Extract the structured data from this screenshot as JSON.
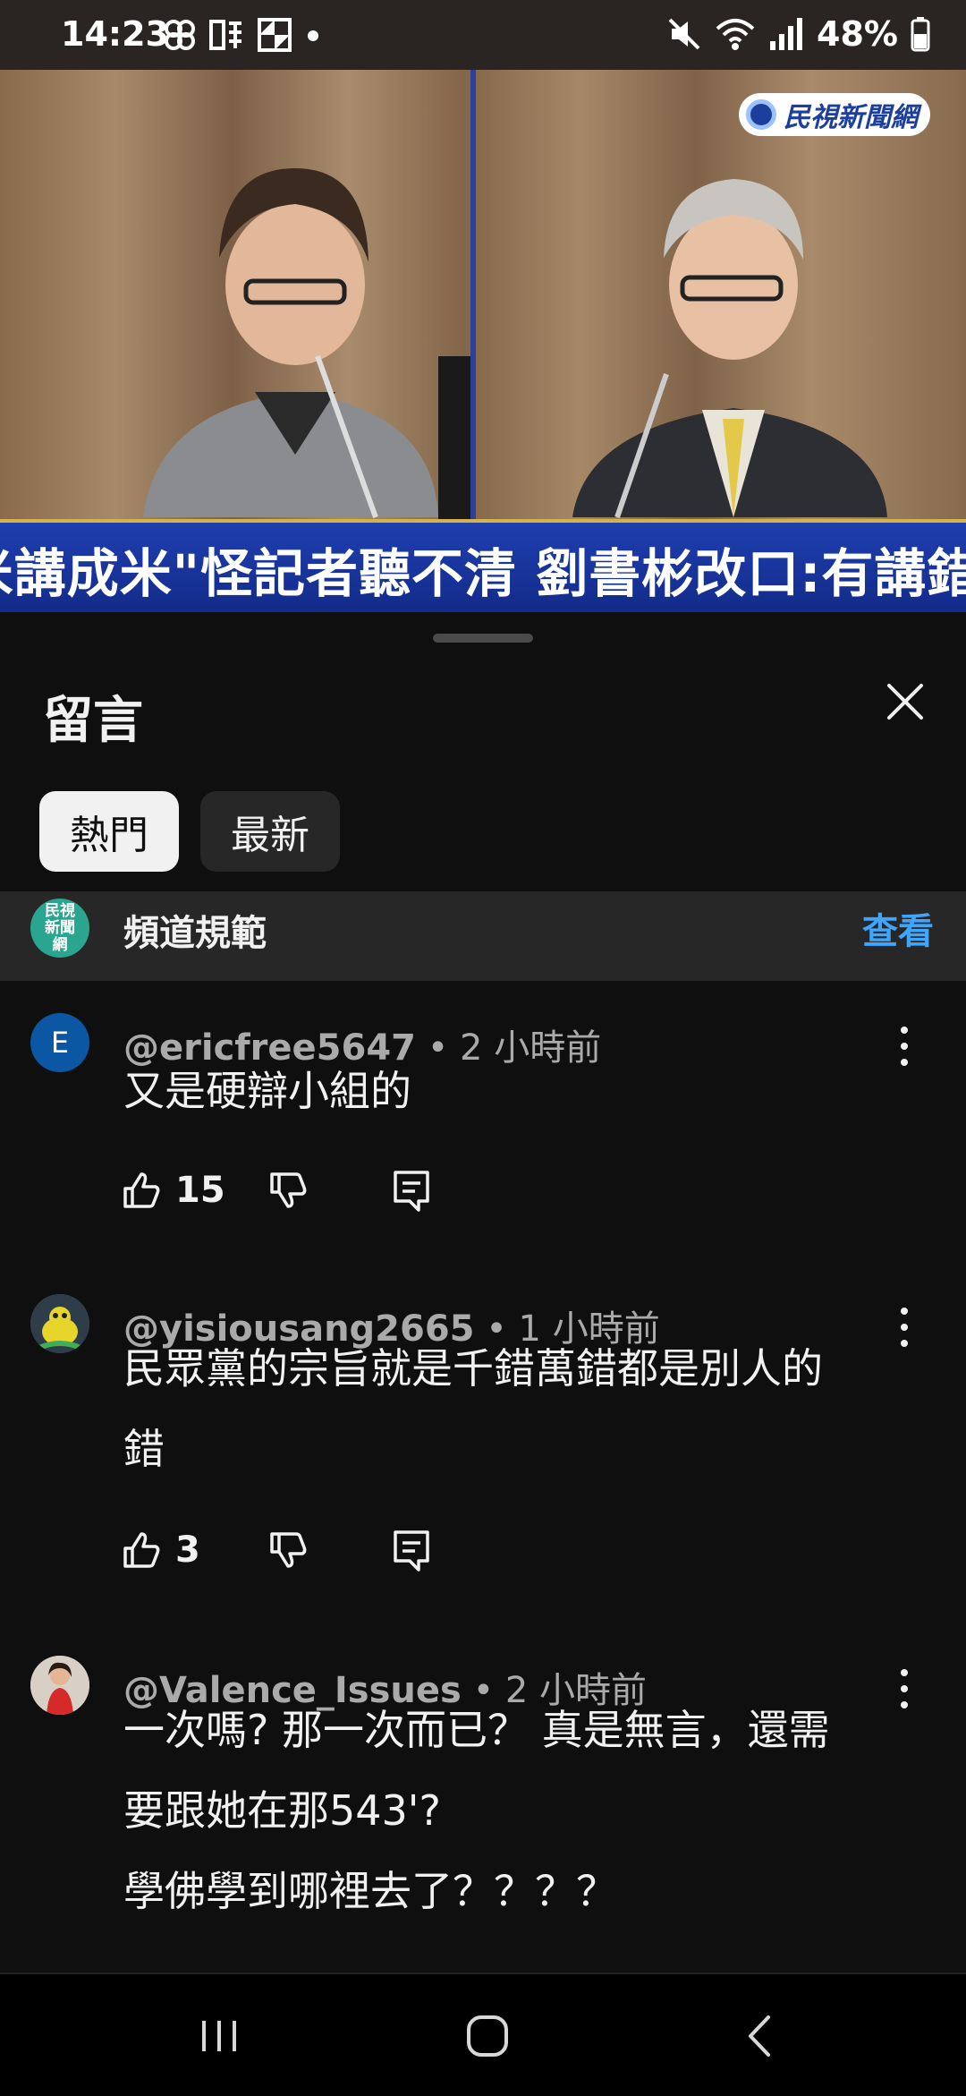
{
  "status": {
    "time": "14:23",
    "battery": "48%"
  },
  "video": {
    "logo": "民視新聞網",
    "headline": "\"奈米講成米\"怪記者聽不清 劉書彬改口:有講錯一次"
  },
  "sheet": {
    "title": "留言",
    "tabs": [
      {
        "label": "熱門",
        "active": true
      },
      {
        "label": "最新",
        "active": false
      }
    ]
  },
  "guidelines": {
    "avatar_text": "民視新聞網",
    "label": "頻道規範",
    "link": "查看"
  },
  "comments": [
    {
      "avatar_letter": "E",
      "author": "@ericfree5647",
      "time": "• 2 小時前",
      "lines": [
        "又是硬辯小組的"
      ],
      "likes": "15"
    },
    {
      "avatar_letter": "",
      "author": "@yisiousang2665",
      "time": "• 1 小時前",
      "lines": [
        "民眾黨的宗旨就是千錯萬錯都是別人的",
        "錯"
      ],
      "likes": "3"
    },
    {
      "avatar_letter": "",
      "author": "@Valence_Issues",
      "time": "• 2 小時前",
      "lines": [
        "一次嗎? 那一次而已？ 真是無言，還需",
        "要跟她在那543'?",
        "學佛學到哪裡去了？？？？"
      ],
      "likes": ""
    }
  ],
  "colors": {
    "accent_link": "#3ea6ff",
    "background": "#0f0f0f",
    "chip_inactive": "#272727",
    "headline_blue": "#1f3fb0"
  }
}
